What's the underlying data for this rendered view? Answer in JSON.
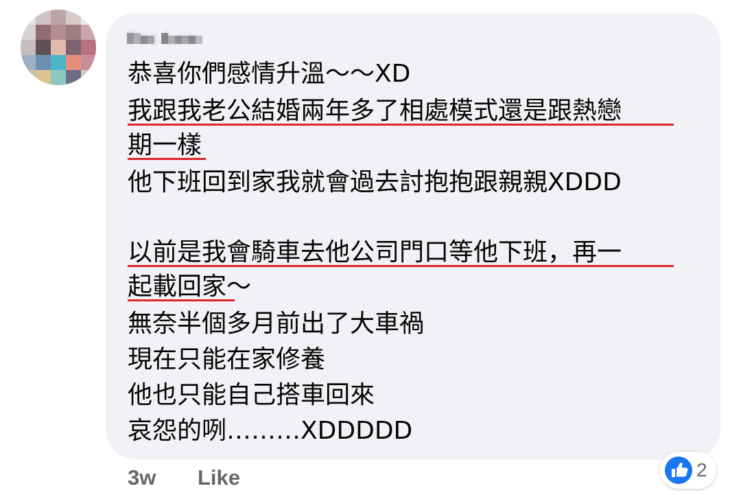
{
  "comment": {
    "author_name": "Pas Lee",
    "lines": [
      "恭喜你們感情升溫～～XD",
      "我跟我老公結婚兩年多了相處模式還是跟熱戀",
      "期一樣",
      "他下班回到家我就會過去討抱抱跟親親XDDD",
      "",
      "以前是我會騎車去他公司門口等他下班，再一",
      "起載回家～",
      "無奈半個多月前出了大車禍",
      "現在只能在家修養",
      "他也只能自己搭車回來",
      "哀怨的咧………XDDDDD"
    ],
    "underline_color": "#e0252a"
  },
  "footer": {
    "timestamp": "3w",
    "like_label": "Like"
  },
  "reactions": {
    "icon": "like-thumb-icon",
    "color": "#1877f2",
    "count": "2"
  }
}
